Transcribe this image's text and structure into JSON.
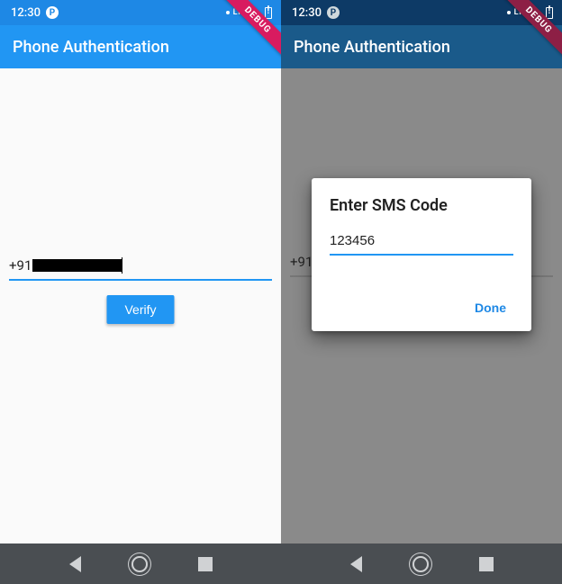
{
  "status": {
    "time": "12:30",
    "lte_label": "LTE",
    "p_glyph": "P"
  },
  "ribbon_label": "DEBUG",
  "app_bar_title": "Phone Authentication",
  "left": {
    "phone_prefix": "+91",
    "verify_label": "Verify"
  },
  "right": {
    "phone_prefix": "+91",
    "dialog": {
      "title": "Enter SMS Code",
      "sms_value": "123456",
      "done_label": "Done"
    }
  }
}
